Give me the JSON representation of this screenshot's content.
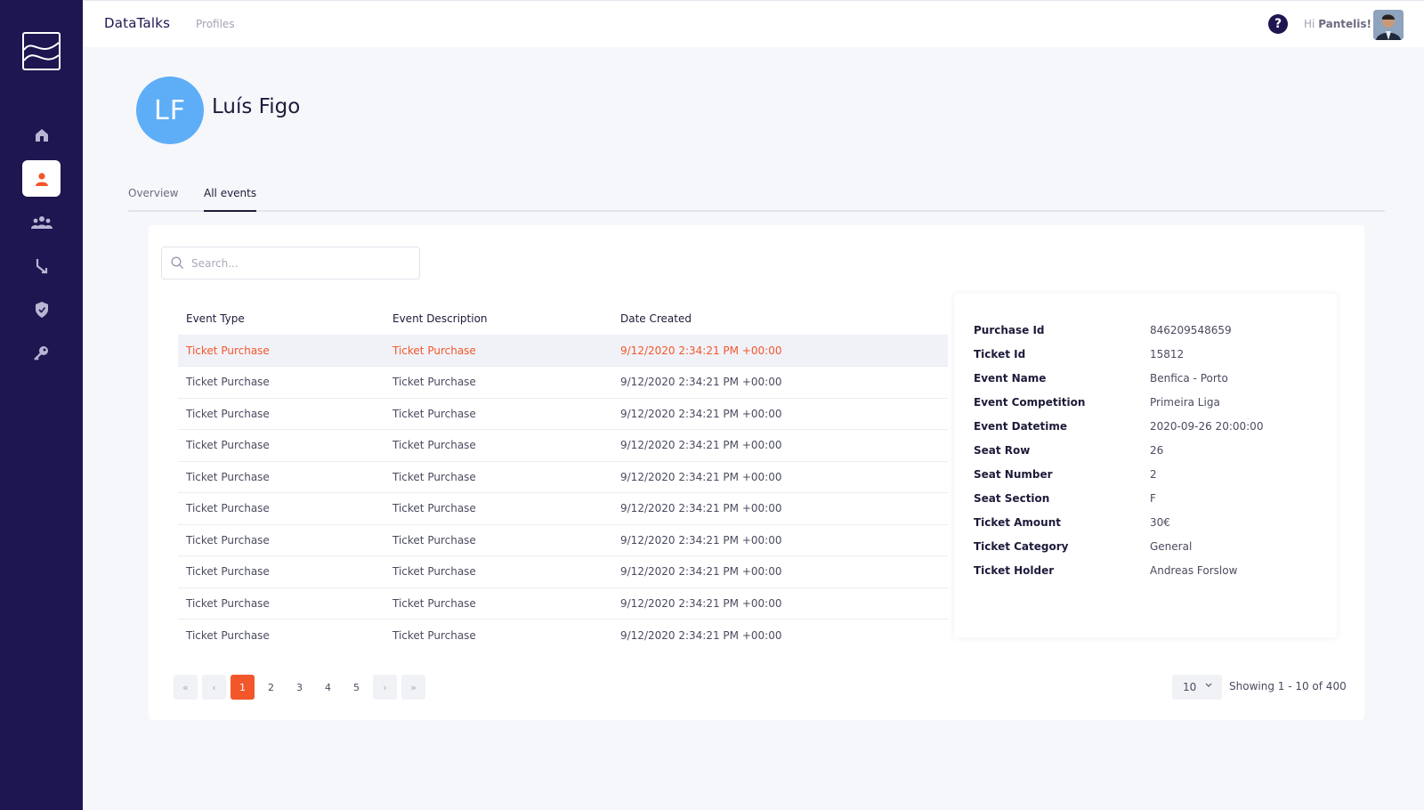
{
  "header": {
    "brand": "DataTalks",
    "breadcrumb": "Profiles",
    "help_label": "?",
    "greeting_prefix": "Hi",
    "greeting_name": "Pantelis!"
  },
  "sidebar": {
    "items": [
      {
        "name": "home-icon",
        "active": false
      },
      {
        "name": "user-icon",
        "active": true
      },
      {
        "name": "users-icon",
        "active": false
      },
      {
        "name": "merge-icon",
        "active": false
      },
      {
        "name": "shield-icon",
        "active": false
      },
      {
        "name": "key-icon",
        "active": false
      }
    ]
  },
  "profile": {
    "initials": "LF",
    "name": "Luís Figo"
  },
  "tabs": [
    {
      "label": "Overview",
      "active": false
    },
    {
      "label": "All events",
      "active": true
    }
  ],
  "search": {
    "placeholder": "Search..."
  },
  "table": {
    "columns": [
      "Event Type",
      "Event Description",
      "Date Created"
    ],
    "rows": [
      [
        "Ticket Purchase",
        "Ticket Purchase",
        "9/12/2020 2:34:21 PM +00:00"
      ],
      [
        "Ticket Purchase",
        "Ticket Purchase",
        "9/12/2020 2:34:21 PM +00:00"
      ],
      [
        "Ticket Purchase",
        "Ticket Purchase",
        "9/12/2020 2:34:21 PM +00:00"
      ],
      [
        "Ticket Purchase",
        "Ticket Purchase",
        "9/12/2020 2:34:21 PM +00:00"
      ],
      [
        "Ticket Purchase",
        "Ticket Purchase",
        "9/12/2020 2:34:21 PM +00:00"
      ],
      [
        "Ticket Purchase",
        "Ticket Purchase",
        "9/12/2020 2:34:21 PM +00:00"
      ],
      [
        "Ticket Purchase",
        "Ticket Purchase",
        "9/12/2020 2:34:21 PM +00:00"
      ],
      [
        "Ticket Purchase",
        "Ticket Purchase",
        "9/12/2020 2:34:21 PM +00:00"
      ],
      [
        "Ticket Purchase",
        "Ticket Purchase",
        "9/12/2020 2:34:21 PM +00:00"
      ],
      [
        "Ticket Purchase",
        "Ticket Purchase",
        "9/12/2020 2:34:21 PM +00:00"
      ]
    ],
    "selected_row": 0
  },
  "details": [
    {
      "label": "Purchase Id",
      "value": "846209548659"
    },
    {
      "label": "Ticket Id",
      "value": "15812"
    },
    {
      "label": "Event Name",
      "value": "Benfica - Porto"
    },
    {
      "label": "Event Competition",
      "value": "Primeira Liga"
    },
    {
      "label": "Event Datetime",
      "value": "2020-09-26 20:00:00"
    },
    {
      "label": "Seat Row",
      "value": "26"
    },
    {
      "label": "Seat Number",
      "value": "2"
    },
    {
      "label": "Seat Section",
      "value": "F"
    },
    {
      "label": "Ticket Amount",
      "value": "30€"
    },
    {
      "label": "Ticket Category",
      "value": "General"
    },
    {
      "label": "Ticket Holder",
      "value": "Andreas Forslow"
    }
  ],
  "pagination": {
    "first": "«",
    "prev": "‹",
    "pages": [
      "1",
      "2",
      "3",
      "4",
      "5"
    ],
    "current": "1",
    "next": "›",
    "last": "»",
    "per_page": "10",
    "showing": "Showing 1 - 10 of 400"
  },
  "colors": {
    "sidebar": "#1e1650",
    "accent": "#f2572b",
    "avatar_bg": "#5eaef7"
  }
}
